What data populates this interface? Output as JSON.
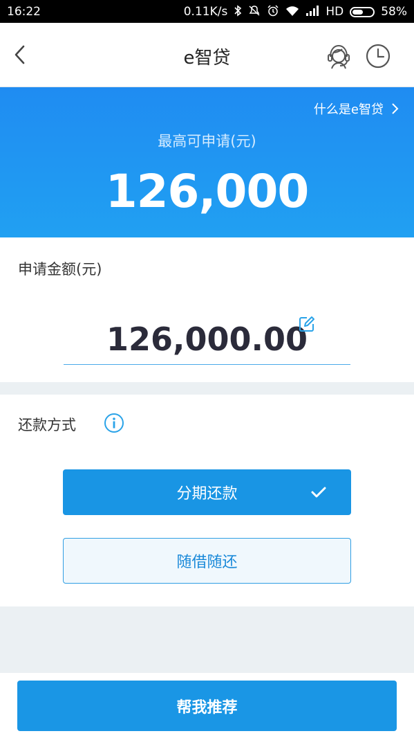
{
  "status_bar": {
    "time": "16:22",
    "network_speed": "0.11K/s",
    "network_type": "HD",
    "battery": "58%",
    "battery_level": 0.58,
    "icons": [
      "bluetooth-icon",
      "mute-icon",
      "alarm-icon",
      "wifi-icon",
      "signal-icon",
      "battery-icon"
    ]
  },
  "header": {
    "title": "e智贷",
    "icons": [
      "back-arrow-icon",
      "customer-service-icon",
      "clock-icon"
    ]
  },
  "hero": {
    "link_text": "什么是e智贷",
    "label": "最高可申请(元)",
    "amount": "126,000"
  },
  "apply": {
    "label": "申请金额(元)",
    "amount_value": "126,000.00"
  },
  "repayment": {
    "label": "还款方式",
    "options": [
      {
        "label": "分期还款",
        "selected": true
      },
      {
        "label": "随借随还",
        "selected": false
      }
    ]
  },
  "footer": {
    "button_label": "帮我推荐"
  },
  "colors": {
    "accent": "#1995e4",
    "hero_gradient_top": "#1f8cf2",
    "hero_gradient_bottom": "#21a0f2",
    "page_bg": "#ebf0f3"
  }
}
